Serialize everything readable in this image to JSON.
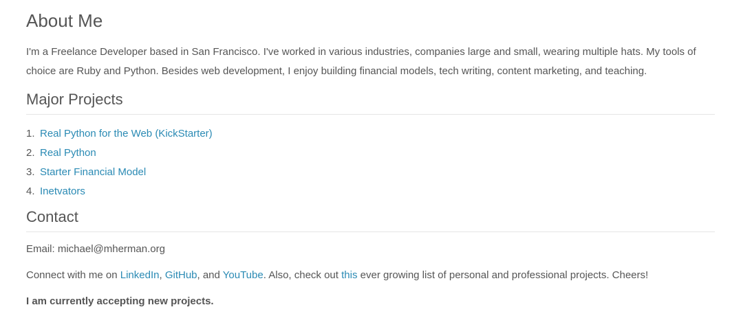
{
  "about": {
    "title": "About Me",
    "intro": "I'm a Freelance Developer based in San Francisco. I've worked in various industries, companies large and small, wearing multiple hats. My tools of choice are Ruby and Python. Besides web development, I enjoy building financial models, tech writing, content marketing, and teaching."
  },
  "projects": {
    "title": "Major Projects",
    "items": [
      {
        "num": "1.",
        "label": "Real Python for the Web (KickStarter)"
      },
      {
        "num": "2.",
        "label": "Real Python"
      },
      {
        "num": "3.",
        "label": "Starter Financial Model"
      },
      {
        "num": "4.",
        "label": "Inetvators"
      }
    ]
  },
  "contact": {
    "title": "Contact",
    "email_text": "Email: michael@mherman.org",
    "connect_prefix": "Connect with me on ",
    "linkedin": "LinkedIn",
    "sep1": ", ",
    "github": "GitHub",
    "sep2": ", and ",
    "youtube": "YouTube",
    "mid_text": ". Also, check out ",
    "this_link": "this",
    "suffix": " ever growing list of personal and professional projects. Cheers!",
    "status": "I am currently accepting new projects."
  },
  "colors": {
    "text": "#555555",
    "link": "#2a8ab4",
    "divider": "#e5e5e5",
    "background": "#ffffff"
  }
}
